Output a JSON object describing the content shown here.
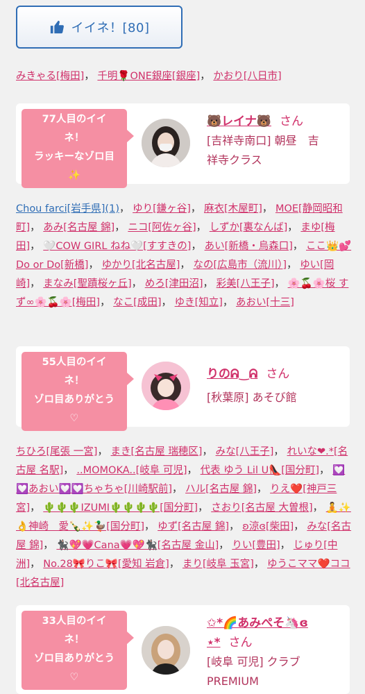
{
  "iine": {
    "label": "イイネ！[80]"
  },
  "top_list": [
    {
      "text": "みきゃる[梅田]"
    },
    {
      "text": "千明🌹ONE銀座[銀座]"
    },
    {
      "text": "かおり[八日市]"
    }
  ],
  "cards": [
    {
      "badge_lines": [
        "77人目のイイ",
        "ネ！",
        "ラッキーなゾロ目",
        "✨"
      ],
      "name": "🐻レイナ🐻",
      "san": "さん",
      "shop_lines": [
        "[吉祥寺南口] 朝昼　吉",
        "祥寺クラス"
      ]
    },
    {
      "badge_lines": [
        "55人目のイイ",
        "ネ！",
        "ゾロ目ありがとう",
        "♡"
      ],
      "name": "りのᕱ‿ᕱ",
      "san": "さん",
      "shop_lines": [
        "[秋葉原] あそび館"
      ]
    },
    {
      "badge_lines": [
        "33人目のイイ",
        "ネ！",
        "ゾロ目ありがとう",
        "♡"
      ],
      "name_lines": [
        "✩*🌈あみぺそ🦄ɞ",
        "⋆*"
      ],
      "san": "さん",
      "shop_lines": [
        "[岐阜 可児] クラブ",
        "PREMIUM"
      ]
    }
  ],
  "list2_lines": [
    "Chou farci[岩手県](1)",
    "ゆり[鎌ヶ谷]",
    "麻衣[木屋町]",
    "MOE[静岡昭和町]",
    "あみ[名古屋 錦]",
    "ニコ[阿佐ヶ谷]",
    "しずか[裏なんば]",
    "まゆ[梅田]",
    "🤍COW GIRL ねね🤍[すすきの]",
    "あい[新橋・烏森口]",
    "ここ👑💕Do or Do[新橋]",
    "ゆかり[北名古屋]",
    "なの[広島市（流川）]",
    "ゆい[岡崎]",
    "まなみ[聖蹟桜ヶ丘]",
    "めろ[津田沼]",
    "彩美[八王子]",
    "🌸🍒🌸桜 すず∞🌸🍒🌸[梅田]",
    "なこ[成田]",
    "ゆき[知立]",
    "あおい[十三]"
  ],
  "list3_lines": [
    "ちひろ[尾張 一宮]",
    "まき[名古屋 瑞穂区]",
    "みな[八王子]",
    "れいな❤︎.*[名古屋 名駅]",
    "..MOMOKA..[岐阜 可児]",
    "代表 ゆう Lil U👠[国分町]",
    "💟💟あおい💟💟ちゃちゃ[川崎駅前]",
    "ハル[名古屋 錦]",
    "りえ❤️[神戸三宮]",
    "🌵🌵🌵IZUMI🌵🌵🌵🌵[国分町]",
    "さおり[名古屋 大曽根]",
    "🧘✨👌神崎　愛🍾✨🦆[国分町]",
    "ゆず[名古屋 錦]",
    "ʚ涼ɞ[柴田]",
    "みな[名古屋 錦]",
    "🐈‍⬛💖💗Cana💗💖🐈‍⬛[名古屋 金山]",
    "りい[豊田]",
    "じゅり[中洲]",
    "No.28🎀りこ🎀[愛知 岩倉]",
    "まり[岐阜 玉宮]",
    "ゆうこママ❤️ココ[北名古屋]"
  ]
}
